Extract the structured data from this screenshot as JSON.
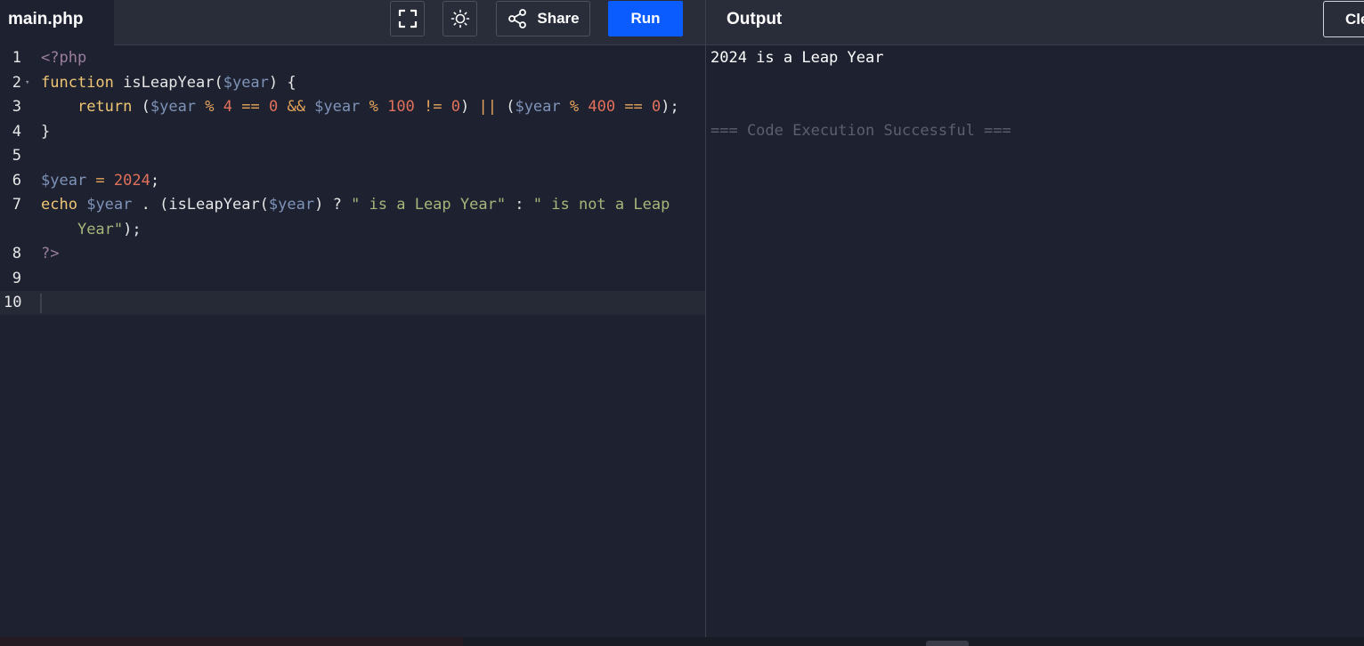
{
  "editor": {
    "filename": "main.php",
    "lines": [
      {
        "n": "1",
        "tokens": [
          [
            "tag",
            "<?php"
          ]
        ]
      },
      {
        "n": "2",
        "fold": true,
        "tokens": [
          [
            "kw",
            "function"
          ],
          [
            "def",
            " isLeapYear("
          ],
          [
            "var",
            "$year"
          ],
          [
            "def",
            ") {"
          ]
        ]
      },
      {
        "n": "3",
        "tokens": [
          [
            "def",
            "    "
          ],
          [
            "kw",
            "return"
          ],
          [
            "def",
            " ("
          ],
          [
            "var",
            "$year"
          ],
          [
            "op",
            " % "
          ],
          [
            "num",
            "4"
          ],
          [
            "op",
            " == "
          ],
          [
            "num",
            "0"
          ],
          [
            "op",
            " && "
          ],
          [
            "var",
            "$year"
          ],
          [
            "op",
            " % "
          ],
          [
            "num",
            "100"
          ],
          [
            "op",
            " != "
          ],
          [
            "num",
            "0"
          ],
          [
            "def",
            ") "
          ],
          [
            "op",
            "||"
          ],
          [
            "def",
            " ("
          ],
          [
            "var",
            "$year"
          ],
          [
            "op",
            " % "
          ],
          [
            "num",
            "400"
          ],
          [
            "op",
            " == "
          ],
          [
            "num",
            "0"
          ],
          [
            "def",
            ");"
          ]
        ]
      },
      {
        "n": "4",
        "tokens": [
          [
            "def",
            "}"
          ]
        ]
      },
      {
        "n": "5",
        "tokens": []
      },
      {
        "n": "6",
        "tokens": [
          [
            "var",
            "$year"
          ],
          [
            "op",
            " = "
          ],
          [
            "num",
            "2024"
          ],
          [
            "def",
            ";"
          ]
        ]
      },
      {
        "n": "7",
        "tokens": [
          [
            "kw",
            "echo"
          ],
          [
            "def",
            " "
          ],
          [
            "var",
            "$year"
          ],
          [
            "def",
            " . (isLeapYear("
          ],
          [
            "var",
            "$year"
          ],
          [
            "def",
            ") ? "
          ],
          [
            "str",
            "\" is a Leap Year\""
          ],
          [
            "def",
            " : "
          ],
          [
            "str",
            "\" is not a Leap"
          ]
        ]
      },
      {
        "n": "",
        "tokens": [
          [
            "def",
            "    "
          ],
          [
            "str",
            "Year\""
          ],
          [
            "def",
            ");"
          ]
        ]
      },
      {
        "n": "8",
        "tokens": [
          [
            "tag",
            "?>"
          ]
        ]
      },
      {
        "n": "9",
        "tokens": []
      },
      {
        "n": "10",
        "active": true,
        "tokens": []
      }
    ]
  },
  "toolbar": {
    "fullscreen_icon": "fullscreen-icon",
    "theme_icon": "sun-icon",
    "share_label": "Share",
    "run_label": "Run"
  },
  "output": {
    "title": "Output",
    "clear_label": "Clear",
    "result": "2024 is a Leap Year",
    "status": "=== Code Execution Successful ==="
  },
  "colors": {
    "run_button": "#0b5cff",
    "background": "#1d2130",
    "topbar": "#292d39"
  }
}
